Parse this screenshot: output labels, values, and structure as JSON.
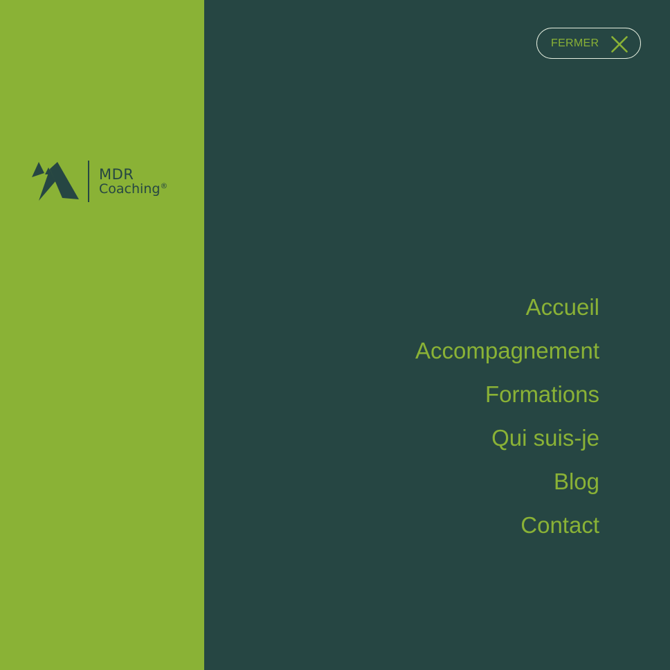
{
  "brand": {
    "line1": "MDR",
    "line2": "Coaching",
    "registered": "®",
    "logo_icon": "mountain-peaks-icon"
  },
  "close": {
    "label": "FERMER",
    "icon": "close-icon"
  },
  "menu": {
    "items": [
      {
        "label": "Accueil"
      },
      {
        "label": "Accompagnement"
      },
      {
        "label": "Formations"
      },
      {
        "label": "Qui suis-je"
      },
      {
        "label": "Blog"
      },
      {
        "label": "Contact"
      }
    ]
  },
  "colors": {
    "accent_green": "#8ab236",
    "dark_teal": "#264643",
    "button_border": "#e6efe0"
  }
}
